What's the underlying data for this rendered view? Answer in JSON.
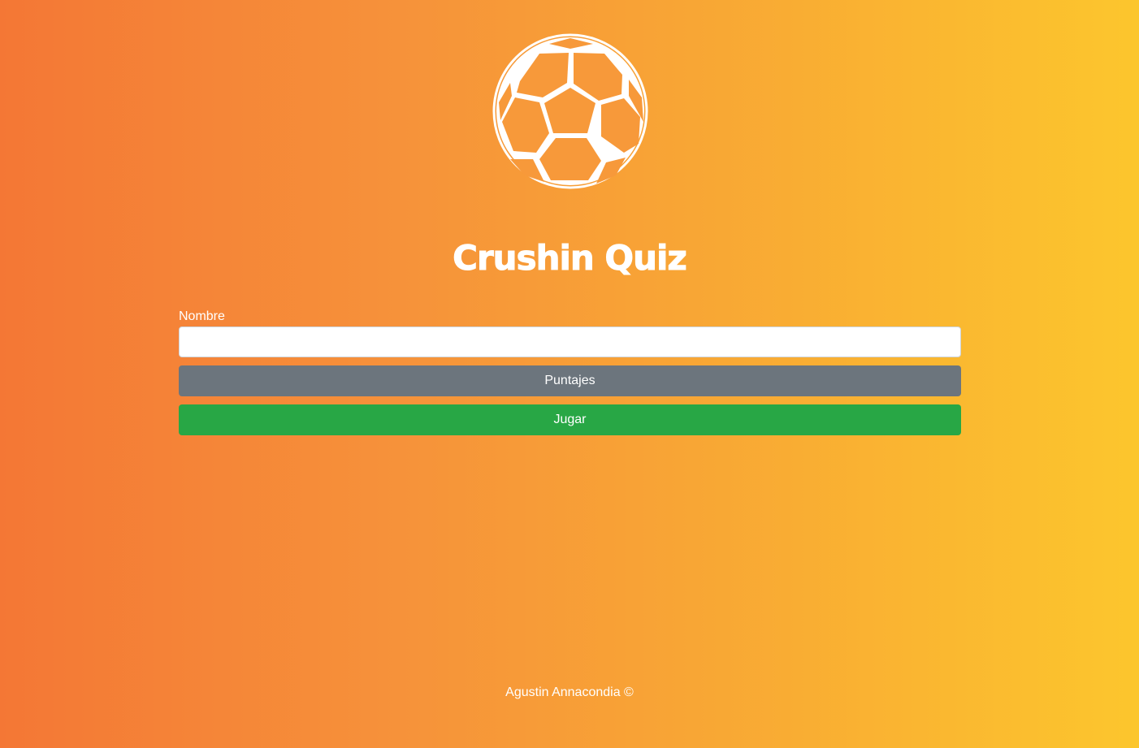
{
  "app": {
    "title": "Crushin Quiz",
    "logo_icon": "soccer-ball-icon"
  },
  "form": {
    "name_label": "Nombre",
    "name_value": "",
    "name_placeholder": "",
    "scores_label": "Puntajes",
    "play_label": "Jugar"
  },
  "footer": {
    "text": "Agustin Annacondia ©"
  },
  "colors": {
    "gradient_start": "#f47735",
    "gradient_end": "#fcc62d",
    "scores_button": "#6c757d",
    "play_button": "#28a745",
    "text": "#ffffff"
  }
}
